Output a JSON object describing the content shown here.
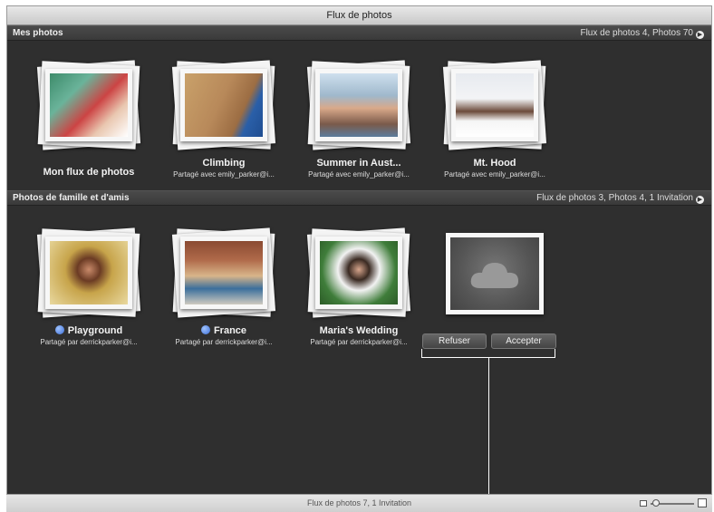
{
  "window": {
    "title": "Flux de photos"
  },
  "sections": [
    {
      "title": "Mes photos",
      "summary": "Flux de photos 4, Photos 70",
      "albums": [
        {
          "title": "Mon flux de photos",
          "subtitle": "",
          "icon": "photo-stream"
        },
        {
          "title": "Climbing",
          "subtitle": "Partagé avec emily_parker@i...",
          "icon": "climbing-photo"
        },
        {
          "title": "Summer in Aust...",
          "subtitle": "Partagé avec emily_parker@i...",
          "icon": "couple-photo"
        },
        {
          "title": "Mt. Hood",
          "subtitle": "Partagé avec emily_parker@i...",
          "icon": "sleigh-photo"
        }
      ]
    },
    {
      "title": "Photos de famille et d'amis",
      "summary": "Flux de photos 3, Photos 4, 1 Invitation",
      "albums": [
        {
          "title": "Playground",
          "subtitle": "Partagé par derrickparker@i...",
          "icon": "child-photo"
        },
        {
          "title": "France",
          "subtitle": "Partagé par derrickparker@i...",
          "icon": "street-photo"
        },
        {
          "title": "Maria's Wedding",
          "subtitle": "Partagé par derrickparker@i...",
          "icon": "bride-photo"
        },
        {
          "title": "",
          "subtitle": "",
          "icon": "cloud-icon"
        }
      ]
    }
  ],
  "invitation": {
    "decline_label": "Refuser",
    "accept_label": "Accepter"
  },
  "status": {
    "text": "Flux de photos 7, 1 Invitation"
  },
  "colors": {
    "background": "#2f2f2f",
    "new_badge": "#3d6fd6"
  }
}
